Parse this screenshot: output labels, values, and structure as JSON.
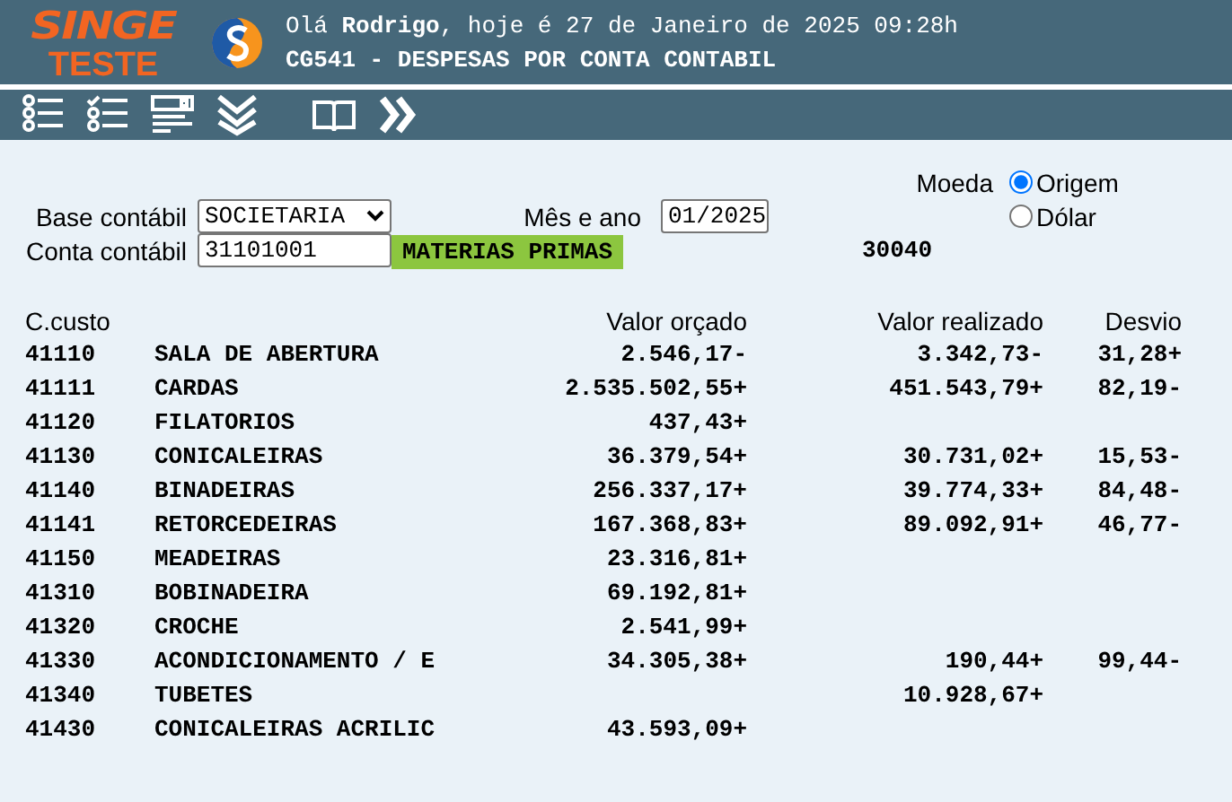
{
  "header": {
    "logo_top": "SINGE",
    "logo_bottom": "TESTE",
    "greeting": "Olá **Rodrigo**, hoje é 27 de Janeiro de 2025 09:28h",
    "title": "CG541 - DESPESAS POR CONTA CONTABIL"
  },
  "toolbar": [
    {
      "kind": "list"
    },
    {
      "kind": "checklist"
    },
    {
      "kind": "form"
    },
    {
      "kind": "chevrons-down"
    },
    {
      "kind": "book"
    },
    {
      "kind": "chevrons-right"
    }
  ],
  "filters": {
    "currency_label": "Moeda",
    "currencies": [
      {
        "label": "Origem",
        "selected": true
      },
      {
        "label": "Dólar",
        "selected": false
      }
    ],
    "base_label": "Base contábil",
    "base_value": "SOCIETARIA",
    "period_label": "Mês e ano",
    "period_value": "01/2025",
    "account_label": "Conta contábil",
    "account_value": "31101001",
    "account_name": "MATERIAS PRIMAS",
    "account_code": "30040"
  },
  "table": {
    "columns": [
      "C.custo",
      "Valor orçado",
      "Valor realizado",
      "Desvio"
    ],
    "rows": [
      {
        "code": "41110",
        "name": "SALA DE ABERTURA",
        "budget": "2.546,17-",
        "actual": "3.342,73-",
        "deviation": "31,28+"
      },
      {
        "code": "41111",
        "name": "CARDAS",
        "budget": "2.535.502,55+",
        "actual": "451.543,79+",
        "deviation": "82,19-"
      },
      {
        "code": "41120",
        "name": "FILATORIOS",
        "budget": "437,43+"
      },
      {
        "code": "41130",
        "name": "CONICALEIRAS",
        "budget": "36.379,54+",
        "actual": "30.731,02+",
        "deviation": "15,53-"
      },
      {
        "code": "41140",
        "name": "BINADEIRAS",
        "budget": "256.337,17+",
        "actual": "39.774,33+",
        "deviation": "84,48-"
      },
      {
        "code": "41141",
        "name": "RETORCEDEIRAS",
        "budget": "167.368,83+",
        "actual": "89.092,91+",
        "deviation": "46,77-"
      },
      {
        "code": "41150",
        "name": "MEADEIRAS",
        "budget": "23.316,81+"
      },
      {
        "code": "41310",
        "name": "BOBINADEIRA",
        "budget": "69.192,81+"
      },
      {
        "code": "41320",
        "name": "CROCHE",
        "budget": "2.541,99+"
      },
      {
        "code": "41330",
        "name": "ACONDICIONAMENTO / E",
        "budget": "34.305,38+",
        "actual": "190,44+",
        "deviation": "99,44-"
      },
      {
        "code": "41340",
        "name": "TUBETES",
        "actual": "10.928,67+"
      },
      {
        "code": "41430",
        "name": "CONICALEIRAS ACRILIC",
        "budget": "43.593,09+"
      }
    ]
  }
}
